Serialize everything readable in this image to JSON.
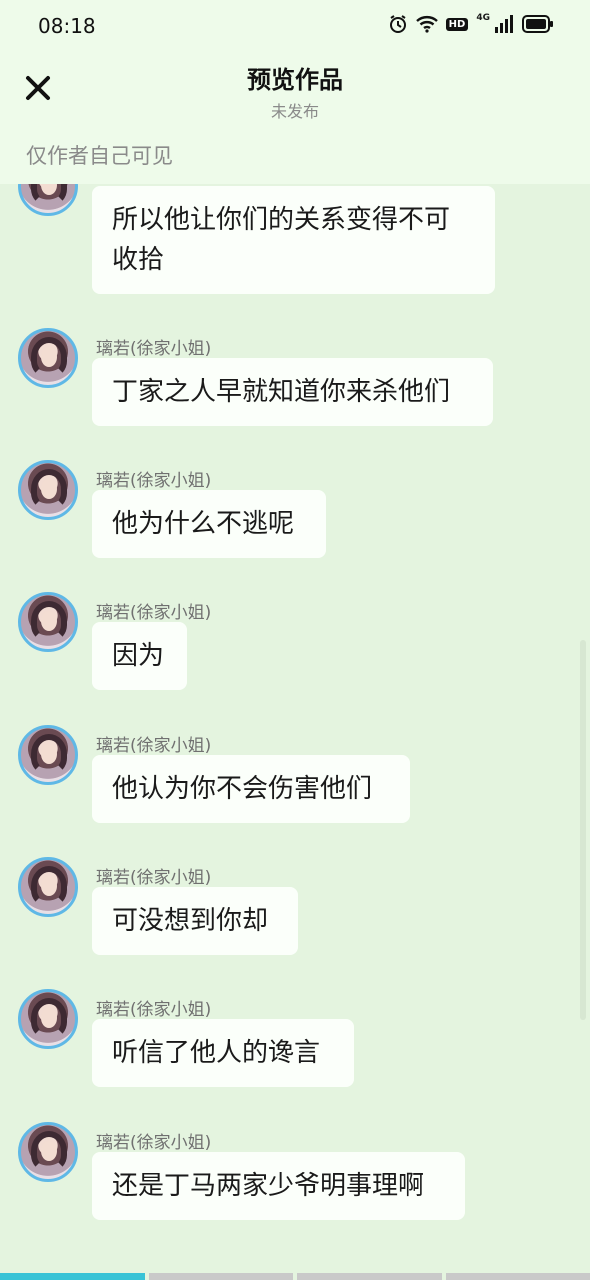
{
  "status_bar": {
    "time": "08:18",
    "hd": "HD",
    "network": "4G"
  },
  "header": {
    "title": "预览作品",
    "subtitle": "未发布",
    "visibility_note": "仅作者自己可见",
    "close_icon": "close-icon"
  },
  "messages": [
    {
      "sender": "",
      "text_lines": [
        "所以他让你们的关系变得不可",
        "收拾"
      ]
    },
    {
      "sender": "璃若(徐家小姐)",
      "text_lines": [
        "丁家之人早就知道你来杀他们"
      ]
    },
    {
      "sender": "璃若(徐家小姐)",
      "text_lines": [
        "他为什么不逃呢"
      ]
    },
    {
      "sender": "璃若(徐家小姐)",
      "text_lines": [
        "因为"
      ]
    },
    {
      "sender": "璃若(徐家小姐)",
      "text_lines": [
        "他认为你不会伤害他们"
      ]
    },
    {
      "sender": "璃若(徐家小姐)",
      "text_lines": [
        "可没想到你却"
      ]
    },
    {
      "sender": "璃若(徐家小姐)",
      "text_lines": [
        "听信了他人的谗言"
      ]
    },
    {
      "sender": "璃若(徐家小姐)",
      "text_lines": [
        "还是丁马两家少爷明事理啊"
      ]
    }
  ],
  "progress": {
    "segments": 4,
    "active_index": 0
  },
  "colors": {
    "accent": "#38c3d6",
    "avatar_ring": "#5fb8e6",
    "background": "#e4f4df"
  }
}
